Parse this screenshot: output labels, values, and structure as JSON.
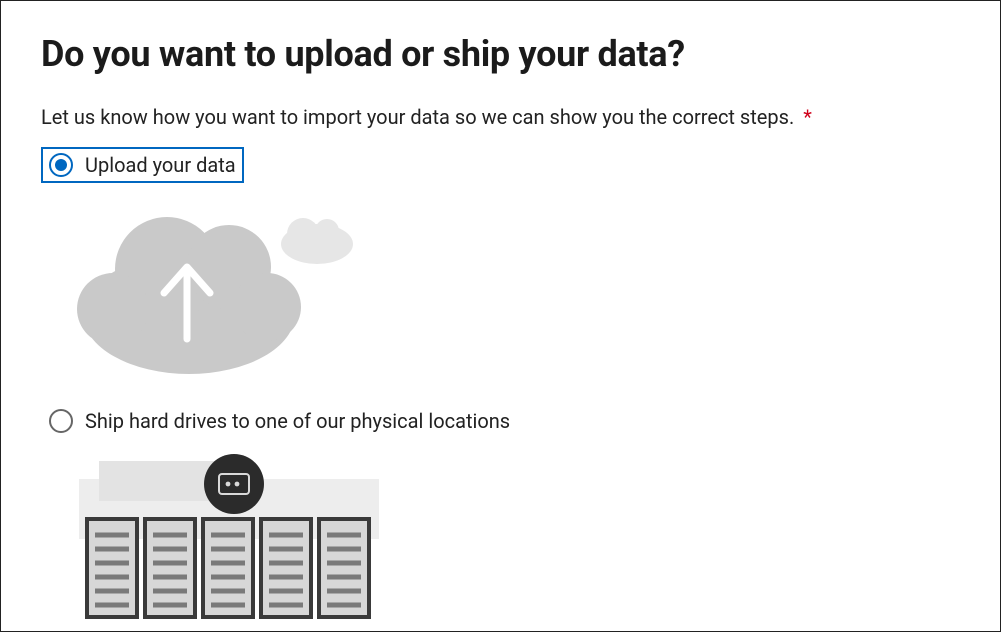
{
  "page": {
    "title": "Do you want to upload or ship your data?",
    "instruction": "Let us know how you want to import your data so we can show you the correct steps.",
    "required_marker": "*"
  },
  "options": {
    "upload": {
      "label": "Upload your data",
      "selected": true
    },
    "ship": {
      "label": "Ship hard drives to one of our physical locations",
      "selected": false
    }
  }
}
